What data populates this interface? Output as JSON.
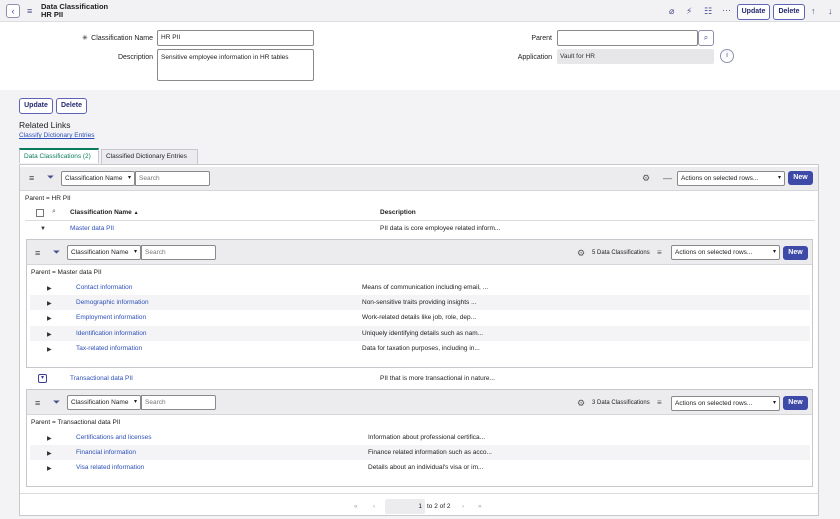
{
  "header": {
    "title": "Data Classification",
    "subtitle": "HR PII",
    "update": "Update",
    "delete": "Delete"
  },
  "form": {
    "classification_name_label": "Classification Name",
    "classification_name_value": "HR PII",
    "description_label": "Description",
    "description_value": "Sensitive employee information in HR tables",
    "parent_label": "Parent",
    "parent_value": "",
    "application_label": "Application",
    "application_value": "Vault for HR"
  },
  "actions": {
    "update": "Update",
    "delete": "Delete"
  },
  "related_links": {
    "title": "Related Links",
    "classify": "Classify Dictionary Entries"
  },
  "tabs": [
    {
      "label": "Data Classifications (2)"
    },
    {
      "label": "Classified Dictionary Entries"
    }
  ],
  "toolbar": {
    "field": "Classification Name",
    "search_placeholder": "Search",
    "actions_label": "Actions on selected rows...",
    "new_label": "New"
  },
  "main_list": {
    "breadcrumb": "Parent = HR PII",
    "col1": "Classification Name",
    "col1_sort": "▲",
    "col2": "Description",
    "rows": [
      {
        "name": "Master data PII",
        "description": "PII data is core employee related inform..."
      },
      {
        "name": "Transactional data PII",
        "description": "PII that is more transactional in nature..."
      }
    ]
  },
  "sub1": {
    "field": "Classification Name",
    "search_placeholder": "Search",
    "count": "5",
    "count_label": "Data Classifications",
    "actions_label": "Actions on selected rows...",
    "new_label": "New",
    "breadcrumb": "Parent = Master data PII",
    "rows": [
      {
        "name": "Contact information",
        "description": "Means of communication including email, ..."
      },
      {
        "name": "Demographic information",
        "description": "Non-sensitive traits providing insights ..."
      },
      {
        "name": "Employment information",
        "description": "Work-related details like job, role, dep..."
      },
      {
        "name": "Identification information",
        "description": "Uniquely identifying details such as nam..."
      },
      {
        "name": "Tax-related information",
        "description": "Data for taxation purposes, including in..."
      }
    ]
  },
  "sub2": {
    "field": "Classification Name",
    "search_placeholder": "Search",
    "count": "3",
    "count_label": "Data Classifications",
    "actions_label": "Actions on selected rows...",
    "new_label": "New",
    "breadcrumb": "Parent = Transactional data PII",
    "rows": [
      {
        "name": "Certifications and licenses",
        "description": "Information about professional certifica..."
      },
      {
        "name": "Financial information",
        "description": "Finance related information such as acco..."
      },
      {
        "name": "Visa related information",
        "description": "Details about an individual's visa or im..."
      }
    ]
  },
  "pagination": {
    "current": "1",
    "range": "to 2 of 2"
  },
  "colors": {
    "accent": "#3d4aa8",
    "link": "#2d4fb8",
    "tab_active": "#0b7a5a"
  }
}
